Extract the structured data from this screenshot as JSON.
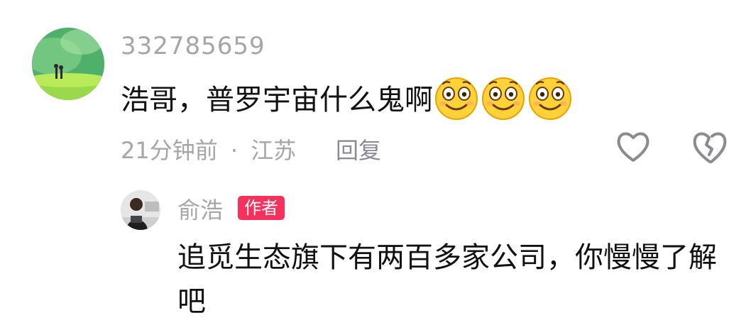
{
  "comment": {
    "username": "332785659",
    "text": "浩哥，普罗宇宙什么鬼啊",
    "emoji_count": 3,
    "emoji_name": "smile-emoji",
    "time": "21分钟前",
    "separator": "·",
    "location": "江苏",
    "reply_label": "回复",
    "like_icon": "heart-outline-icon",
    "dislike_icon": "broken-heart-icon"
  },
  "reply": {
    "username": "俞浩",
    "badge": "作者",
    "text": "追觅生态旗下有两百多家公司，你慢慢了解吧"
  },
  "colors": {
    "badge": "#f5315c",
    "muted_text": "#a5a5aa",
    "main_text": "#111111"
  }
}
